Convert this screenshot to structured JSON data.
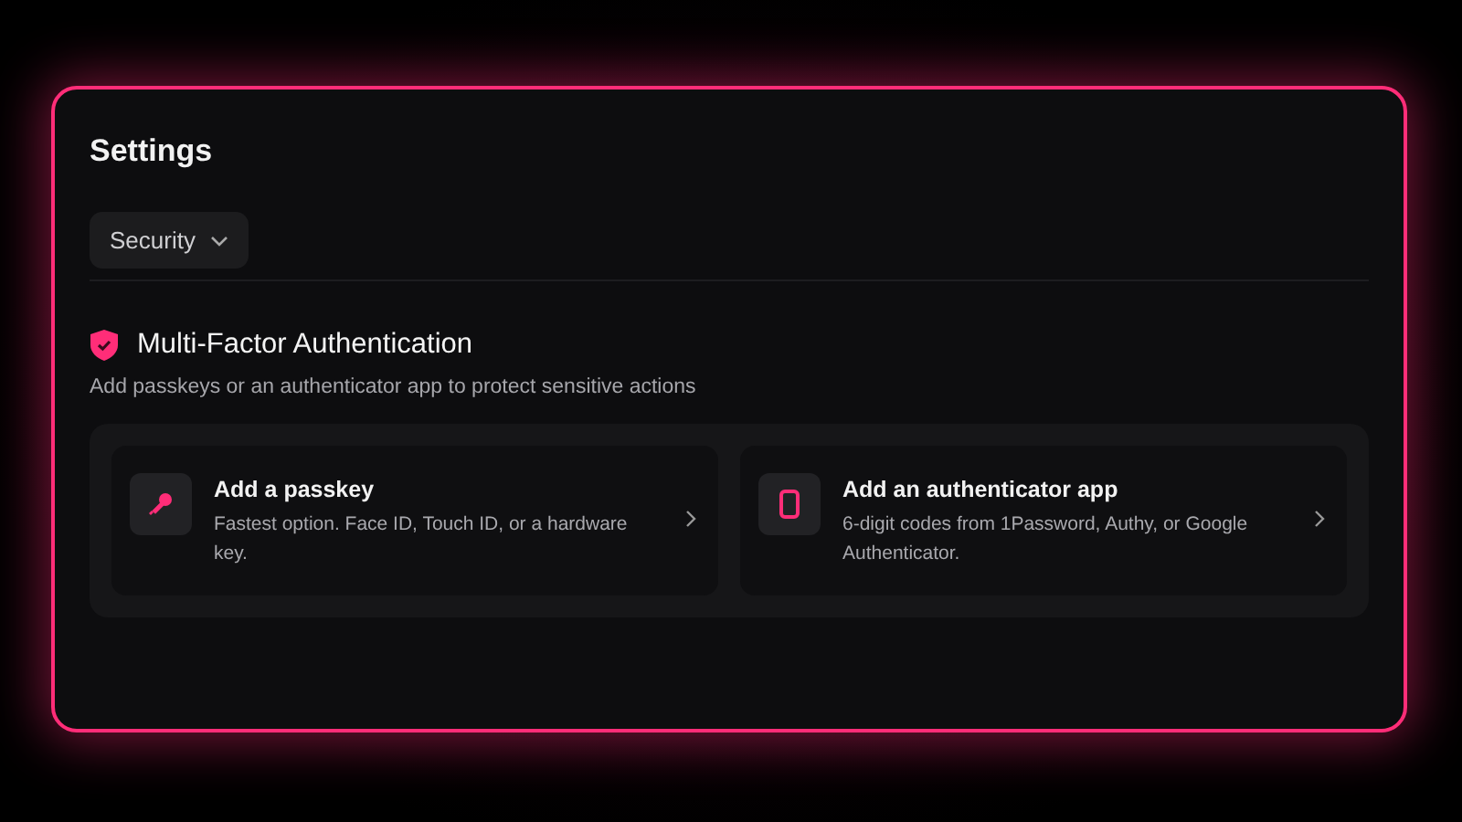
{
  "panel": {
    "title": "Settings"
  },
  "section_select": {
    "value": "Security"
  },
  "section": {
    "title": "Multi-Factor Authentication",
    "description": "Add passkeys or an authenticator app to protect sensitive actions"
  },
  "options": [
    {
      "kind": "passkey",
      "title": "Add a passkey",
      "description": "Fastest option. Face ID, Touch ID, or a hardware key."
    },
    {
      "kind": "app",
      "title": "Add an authenticator app",
      "description": "6-digit codes from 1Password, Authy, or Google Authenticator."
    }
  ]
}
